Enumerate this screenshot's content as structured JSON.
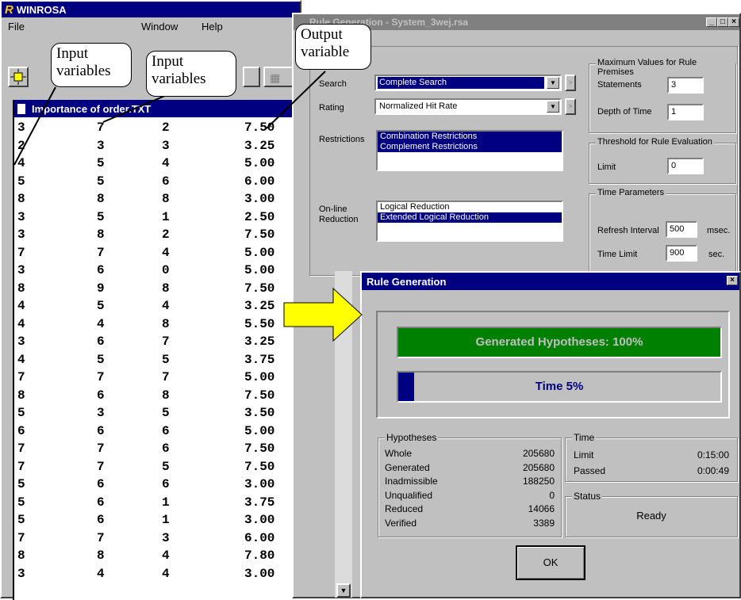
{
  "winrosa": {
    "title": "WINROSA",
    "menu": [
      "File",
      "Window",
      "Help"
    ],
    "doc_title": "Importance of order.TXT",
    "rows": [
      [
        "3",
        "7",
        "2",
        "7.50"
      ],
      [
        "2",
        "3",
        "3",
        "3.25"
      ],
      [
        "4",
        "5",
        "4",
        "5.00"
      ],
      [
        "5",
        "5",
        "6",
        "6.00"
      ],
      [
        "8",
        "8",
        "8",
        "3.00"
      ],
      [
        "3",
        "5",
        "1",
        "2.50"
      ],
      [
        "3",
        "8",
        "2",
        "7.50"
      ],
      [
        "7",
        "7",
        "4",
        "5.00"
      ],
      [
        "3",
        "6",
        "0",
        "5.00"
      ],
      [
        "8",
        "9",
        "8",
        "7.50"
      ],
      [
        "4",
        "5",
        "4",
        "3.25"
      ],
      [
        "4",
        "4",
        "8",
        "5.50"
      ],
      [
        "3",
        "6",
        "7",
        "3.25"
      ],
      [
        "4",
        "5",
        "5",
        "3.75"
      ],
      [
        "7",
        "7",
        "7",
        "5.00"
      ],
      [
        "8",
        "6",
        "8",
        "7.50"
      ],
      [
        "5",
        "3",
        "5",
        "3.50"
      ],
      [
        "6",
        "6",
        "6",
        "5.00"
      ],
      [
        "7",
        "7",
        "6",
        "7.50"
      ],
      [
        "7",
        "7",
        "5",
        "7.50"
      ],
      [
        "5",
        "6",
        "6",
        "3.00"
      ],
      [
        "5",
        "6",
        "1",
        "3.75"
      ],
      [
        "5",
        "6",
        "1",
        "3.00"
      ],
      [
        "7",
        "7",
        "3",
        "6.00"
      ],
      [
        "8",
        "8",
        "4",
        "7.80"
      ],
      [
        "3",
        "4",
        "4",
        "3.00"
      ]
    ]
  },
  "callouts": {
    "input1": [
      "Input",
      "variables"
    ],
    "input2": [
      "Input",
      "variables"
    ],
    "output": [
      "Output",
      "variable"
    ]
  },
  "settings": {
    "title": "Rule Generation - System_3wej.rsa",
    "search_label": "Search",
    "search_value": "Complete Search",
    "rating_label": "Rating",
    "rating_value": "Normalized Hit Rate",
    "restrictions_label": "Restrictions",
    "restrictions_items": [
      "Combination Restrictions",
      "Complement Restrictions"
    ],
    "online_label": [
      "On-line",
      "Reduction"
    ],
    "online_items": [
      "Logical Reduction",
      "Extended Logical Reduction"
    ],
    "max_group": "Maximum Values for Rule Premises",
    "statements_label": "Statements",
    "statements_value": "3",
    "depth_label": "Depth of Time",
    "depth_value": "1",
    "threshold_group": "Threshold for Rule Evaluation",
    "limit_label": "Limit",
    "limit_value": "0",
    "time_group": "Time Parameters",
    "refresh_label": "Refresh Interval",
    "refresh_value": "500",
    "refresh_unit": "msec.",
    "timelimit_label": "Time Limit",
    "timelimit_value": "900",
    "timelimit_unit": "sec."
  },
  "progress": {
    "title": "Rule Generation",
    "hyp_bar_label": "Generated Hypotheses: 100%",
    "hyp_fraction": 1.0,
    "time_bar_label": "Time 5%",
    "time_fraction": 0.05,
    "hyp_group": "Hypotheses",
    "hyp_rows": [
      {
        "label": "Whole",
        "value": "205680"
      },
      {
        "label": "Generated",
        "value": "205680"
      },
      {
        "label": "Inadmissible",
        "value": "188250"
      },
      {
        "label": "Unqualified",
        "value": "0"
      },
      {
        "label": "Reduced",
        "value": "14066"
      },
      {
        "label": "Verified",
        "value": "3389"
      }
    ],
    "time_group": "Time",
    "time_rows": [
      {
        "label": "Limit",
        "value": "0:15:00"
      },
      {
        "label": "Passed",
        "value": "0:00:49"
      }
    ],
    "status_group": "Status",
    "status_value": "Ready",
    "ok_label": "OK"
  },
  "colors": {
    "titlebar": "#000080",
    "progress_green": "#008000",
    "progress_blue": "#000080",
    "arrow": "#ffff00"
  }
}
